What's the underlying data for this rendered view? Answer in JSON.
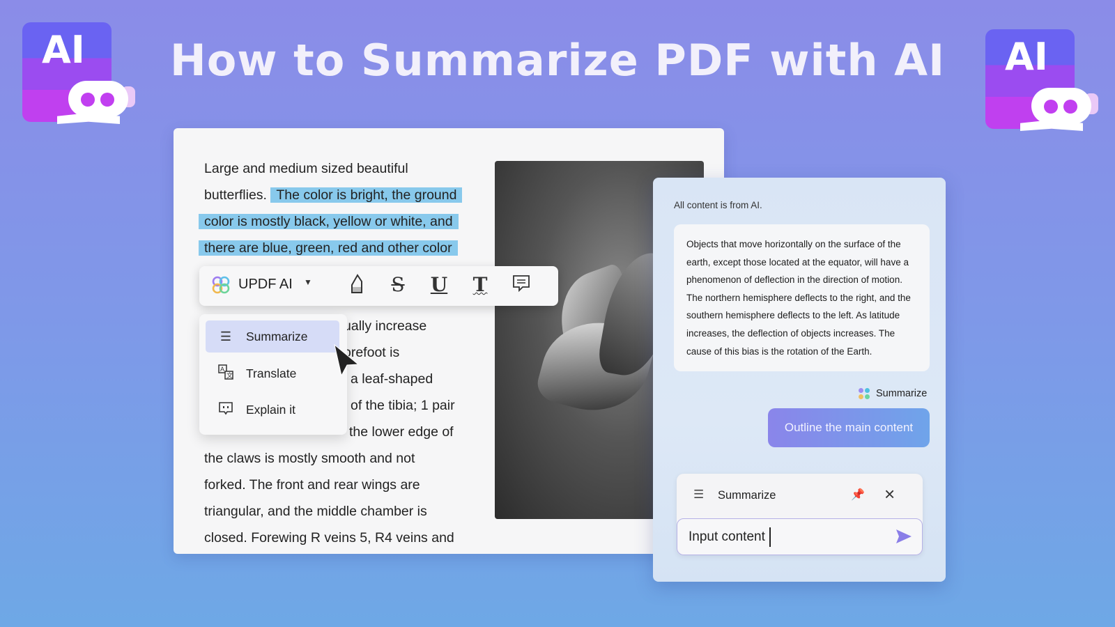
{
  "banner": {
    "title": "How to Summarize PDF with AI",
    "logo_text": "AI"
  },
  "document": {
    "lines": [
      {
        "pre": "Large and medium sized beautiful",
        "hl": ""
      },
      {
        "pre": "butterflies. ",
        "hl": "The color is bright, the ground"
      },
      {
        "pre": "",
        "hl": "color is mostly black, yellow or white, and"
      },
      {
        "pre": "",
        "hl": "there are blue, green, red and other color"
      }
    ],
    "partial_lines": [
      "ually increase",
      "orefoot is",
      "a leaf-shaped",
      "of the tibia; 1 pair",
      "the lower edge of"
    ],
    "full_lines": [
      "the claws is mostly smooth and not",
      "forked. The front and rear wings are",
      "triangular, and the middle chamber is",
      "closed. Forewing R veins 5, R4 veins and"
    ]
  },
  "toolbar": {
    "ai_label": "UPDF AI",
    "tools": [
      "highlight-icon",
      "strikethrough-icon",
      "underline-icon",
      "squiggly-text-icon",
      "comment-icon"
    ]
  },
  "menu": {
    "items": [
      {
        "label": "Summarize",
        "icon": "list-icon"
      },
      {
        "label": "Translate",
        "icon": "translate-icon"
      },
      {
        "label": "Explain it",
        "icon": "explain-icon"
      }
    ]
  },
  "ai_panel": {
    "notice": "All content is from AI.",
    "response": "Objects that move horizontally on the surface of the earth, except those located at the equator, will have a phenomenon of deflection in the direction of motion. The northern hemisphere deflects to the right, and the southern hemisphere deflects to the left. As latitude increases, the deflection of objects increases. The cause of this bias is the rotation of the Earth.",
    "tag": "Summarize",
    "user_message": "Outline the main content",
    "prompt_box": {
      "mode": "Summarize",
      "input_value": "Input content"
    }
  },
  "colors": {
    "highlight": "#88c9ec",
    "accent": "#8a85ea",
    "menu_selected": "#d6dcf7"
  }
}
